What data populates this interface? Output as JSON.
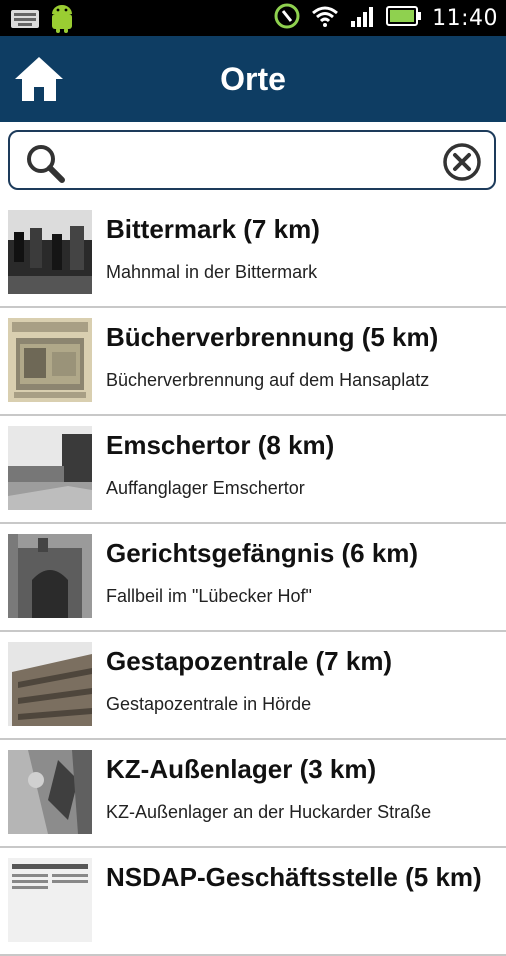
{
  "status_bar": {
    "time": "11:40",
    "icons": [
      "keyboard-icon",
      "android-icon",
      "nfc-icon",
      "wifi-icon",
      "signal-icon",
      "battery-icon"
    ]
  },
  "app_bar": {
    "title": "Orte",
    "home_icon": "home-icon",
    "background": "#0e3d63"
  },
  "search": {
    "value": "",
    "placeholder": "",
    "search_icon": "search-icon",
    "clear_icon": "clear-icon"
  },
  "places": [
    {
      "title": "Bittermark (7 km)",
      "subtitle": "Mahnmal in der Bittermark"
    },
    {
      "title": "Bücherverbrennung (5 km)",
      "subtitle": "Bücherverbrennung auf dem Hansaplatz"
    },
    {
      "title": "Emschertor (8 km)",
      "subtitle": "Auffanglager Emschertor"
    },
    {
      "title": "Gerichtsgefängnis  (6 km)",
      "subtitle": "Fallbeil im \"Lübecker Hof\""
    },
    {
      "title": "Gestapozentrale (7 km)",
      "subtitle": "Gestapozentrale in Hörde"
    },
    {
      "title": "KZ-Außenlager (3 km)",
      "subtitle": "KZ-Außenlager an der Huckarder Straße"
    },
    {
      "title": "NSDAP-Geschäftsstelle (5 km)",
      "subtitle": ""
    }
  ]
}
